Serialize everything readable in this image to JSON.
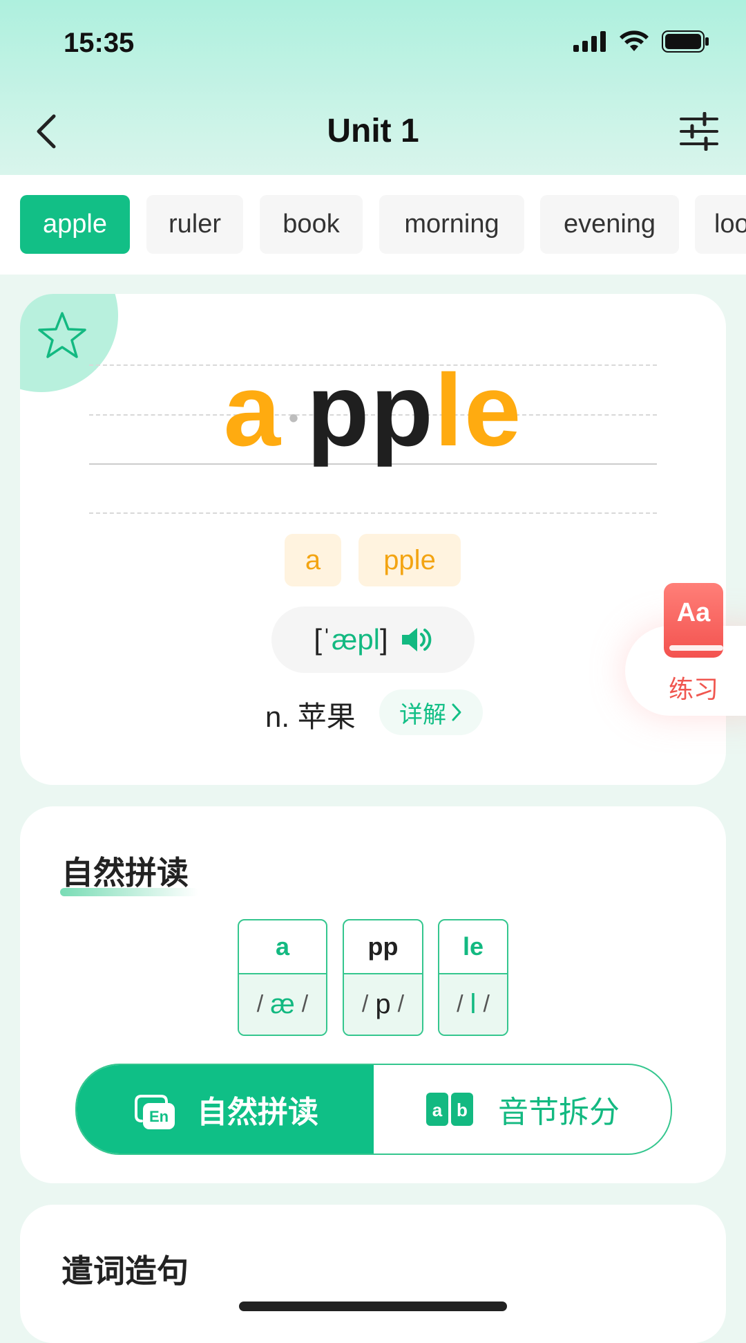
{
  "status": {
    "time": "15:35"
  },
  "nav": {
    "title": "Unit 1"
  },
  "tabs": [
    "apple",
    "ruler",
    "book",
    "morning",
    "evening",
    "loo"
  ],
  "word": {
    "part1": "a",
    "dot": "•",
    "part2": "pp",
    "part3": "l",
    "part4": "e",
    "syllables": [
      "a",
      "pple"
    ],
    "phonetic_open": "[ˈ",
    "phonetic_ipa": "æpl",
    "phonetic_close": "]",
    "meaning": "n. 苹果",
    "detail": "详解",
    "detail_arrow": ">"
  },
  "practice": {
    "icon_text": "Aa",
    "label": "练习"
  },
  "phonics": {
    "title": "自然拼读",
    "boxes": [
      {
        "letters": "a",
        "sound": "æ"
      },
      {
        "letters": "pp",
        "sound": "p"
      },
      {
        "letters": "le",
        "sound": "l"
      }
    ],
    "slash": "/",
    "mode_left_icon": "En",
    "mode_left": "自然拼读",
    "mode_right_icon_a": "a",
    "mode_right_icon_b": "b",
    "mode_right": "音节拆分"
  },
  "sentence": {
    "title": "遣词造句"
  },
  "colors": {
    "accent": "#12bf86",
    "highlight": "#ffab10",
    "practice": "#f3524f"
  }
}
